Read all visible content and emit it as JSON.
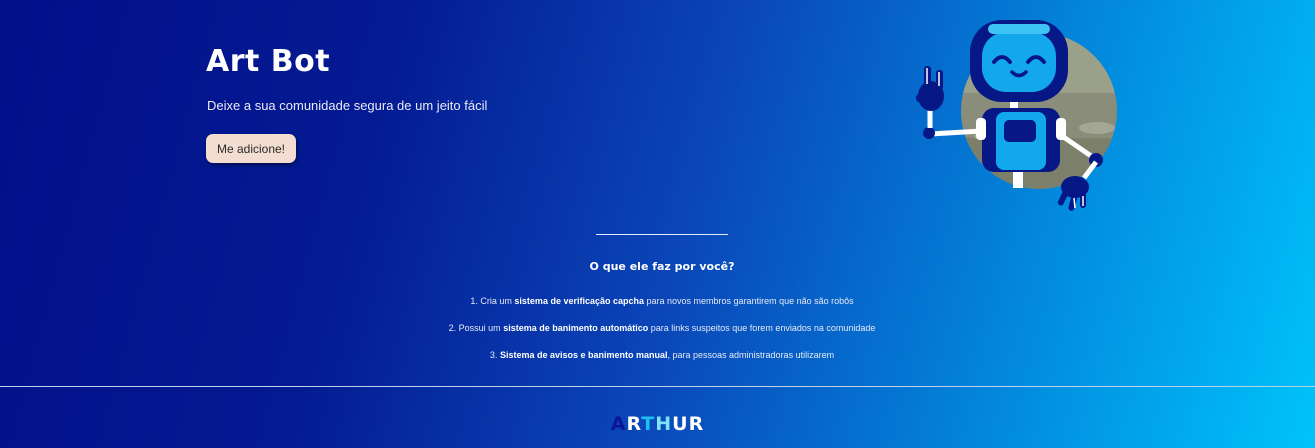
{
  "hero": {
    "title": "Art Bot",
    "subtitle": "Deixe a sua comunidade segura de um jeito fácil",
    "add_button": "Me adicione!"
  },
  "features": {
    "title": "O que ele faz por você?",
    "items": [
      {
        "number": "1.",
        "pre": "Cria um",
        "bold": "sistema de verificação capcha",
        "post": "para novos membros garantirem que não são robôs"
      },
      {
        "number": "2.",
        "pre": "Possui um",
        "bold": "sistema de banimento automático",
        "post": "para links suspeitos que forem enviados na comunidade"
      },
      {
        "number": "3.",
        "pre": "",
        "bold": "Sistema de avisos e banimento manual",
        "post": ", para pessoas administradoras utilizarem"
      }
    ]
  },
  "footer": {
    "logo_letters": [
      {
        "char": "A",
        "color": "#0a1596"
      },
      {
        "char": "R",
        "color": "#ffffff"
      },
      {
        "char": "T",
        "color": "#1ec0f0"
      },
      {
        "char": "H",
        "color": "#7fe3f5"
      },
      {
        "char": "U",
        "color": "#ffffff"
      },
      {
        "char": "R",
        "color": "#ffffff"
      }
    ]
  },
  "colors": {
    "button_bg": "#f2ddd0",
    "robot_dark": "#061786",
    "robot_light": "#13a7ec",
    "gradient_start": "#02108a",
    "gradient_end": "#00c3fc"
  }
}
